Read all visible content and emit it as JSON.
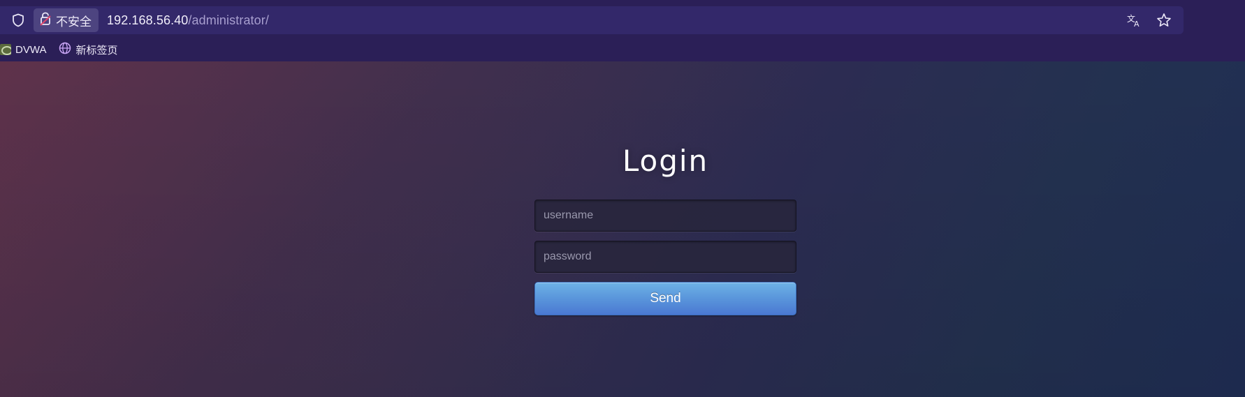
{
  "browser": {
    "security_label": "不安全",
    "url_host": "192.168.56.40",
    "url_path": "/administrator/",
    "icons": {
      "shield": "shield-icon",
      "lock": "insecure-lock-icon",
      "translate": "translate-icon",
      "bookmark_star": "star-icon"
    },
    "bookmarks": [
      {
        "label": "DVWA",
        "icon": "dvwa-favicon"
      },
      {
        "label": "新标签页",
        "icon": "globe-icon"
      }
    ]
  },
  "login": {
    "title": "Login",
    "username_placeholder": "username",
    "password_placeholder": "password",
    "submit_label": "Send"
  },
  "colors": {
    "chrome_bg": "#2b1f57",
    "addressbar_bg": "#33286a",
    "button_top": "#6eb2e6",
    "button_bottom": "#4a78d2"
  }
}
